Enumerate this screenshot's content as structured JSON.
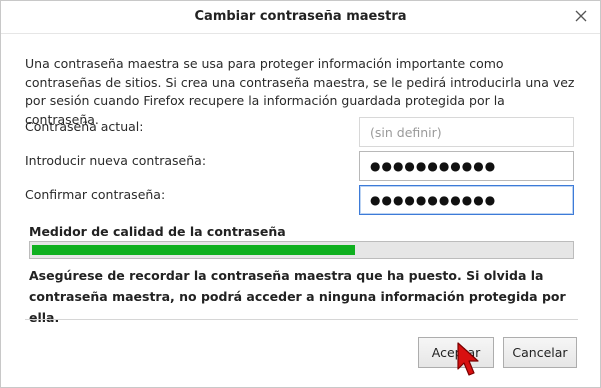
{
  "dialog": {
    "title": "Cambiar contraseña maestra"
  },
  "intro": {
    "text": "Una contraseña maestra se usa para proteger información importante como contraseñas de sitios. Si crea una contraseña maestra, se le pedirá introducirla una vez por sesión cuando Firefox recupere la información guardada protegida por la contraseña."
  },
  "fields": {
    "current_label": "Contraseña actual:",
    "current_placeholder": "(sin definir)",
    "new_label": "Introducir nueva contraseña:",
    "new_value": "●●●●●●●●●●●",
    "confirm_label": "Confirmar contraseña:",
    "confirm_value": "●●●●●●●●●●●"
  },
  "meter": {
    "label": "Medidor de calidad de la contraseña",
    "level_percent": 60,
    "color": "#0fb01f"
  },
  "warning": {
    "text": "Asegúrese de recordar la contraseña maestra que ha puesto. Si olvida la contraseña maestra, no podrá acceder a ninguna información protegida por ella."
  },
  "buttons": {
    "accept_label": "Aceptar",
    "cancel_label": "Cancelar"
  },
  "icons": {
    "close": "close-icon",
    "cursor": "mouse-pointer-icon"
  }
}
